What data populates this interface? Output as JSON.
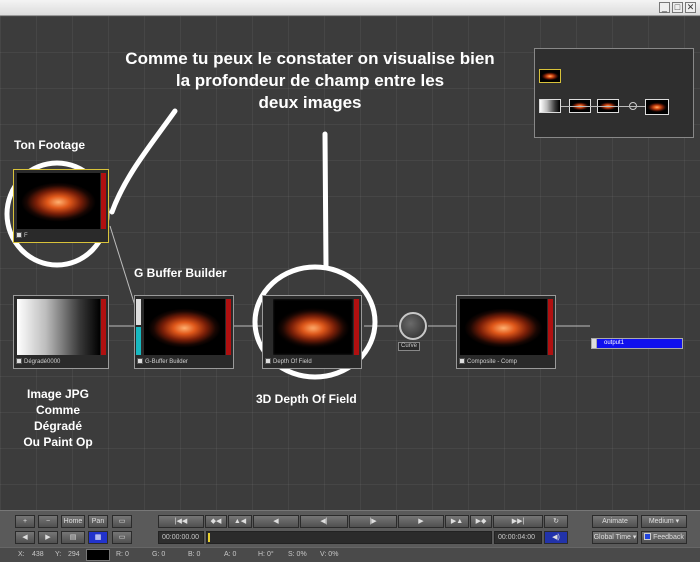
{
  "window": {
    "minimize": "_",
    "maximize": "□",
    "close": "✕"
  },
  "annotations": {
    "headline_line1": "Comme tu peux le constater on visualise bien",
    "headline_line2": "la profondeur de champ entre les",
    "headline_line3": "deux images",
    "ton_footage": "Ton Footage",
    "gbuffer": "G Buffer Builder",
    "depth": "3D Depth Of Field",
    "jpg_line1": "Image JPG",
    "jpg_line2": "Comme",
    "jpg_line3": "Dégradé",
    "jpg_line4": "Ou Paint Op"
  },
  "nodes": {
    "footage": "F",
    "gradient": "Dégradé0000",
    "gbuffer": "G-Buffer Builder",
    "depth": "Depth Of Field",
    "curve": "Curve",
    "composite": "Composite - Comp",
    "output": "output1"
  },
  "controls": {
    "plus": "+",
    "minus": "−",
    "home": "Home",
    "pan": "Pan",
    "start_time": "00:00:00.00",
    "end_time": "00:00:04:00",
    "animate": "Animate",
    "quality": "Medium",
    "global_time": "Global Time",
    "feedback": "Feedback"
  },
  "status": {
    "x_label": "X:",
    "x_value": "438",
    "y_label": "Y:",
    "y_value": "294",
    "r": "R: 0",
    "g": "G: 0",
    "b": "B: 0",
    "a": "A: 0",
    "h": "H: 0°",
    "s": "S: 0%",
    "v": "V: 0%"
  },
  "colors": {
    "accent": "#1010ee",
    "node_red": "#b01010",
    "gbuffer_cyan": "#18b8c0",
    "annotation": "#ffffff"
  }
}
